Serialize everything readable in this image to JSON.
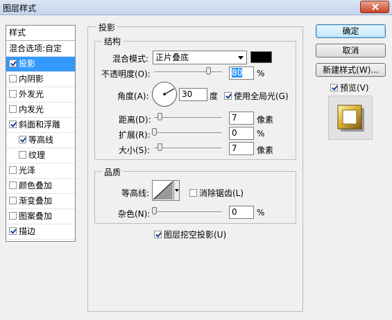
{
  "window": {
    "title": "图层样式"
  },
  "sidebar": {
    "header": "样式",
    "items": [
      {
        "label": "混合选项:自定",
        "checkbox": false,
        "checked": false,
        "selected": false,
        "sub": false
      },
      {
        "label": "投影",
        "checkbox": true,
        "checked": true,
        "selected": true,
        "sub": false
      },
      {
        "label": "内阴影",
        "checkbox": true,
        "checked": false,
        "selected": false,
        "sub": false
      },
      {
        "label": "外发光",
        "checkbox": true,
        "checked": false,
        "selected": false,
        "sub": false
      },
      {
        "label": "内发光",
        "checkbox": true,
        "checked": false,
        "selected": false,
        "sub": false
      },
      {
        "label": "斜面和浮雕",
        "checkbox": true,
        "checked": true,
        "selected": false,
        "sub": false
      },
      {
        "label": "等高线",
        "checkbox": true,
        "checked": true,
        "selected": false,
        "sub": true
      },
      {
        "label": "纹理",
        "checkbox": true,
        "checked": false,
        "selected": false,
        "sub": true
      },
      {
        "label": "光泽",
        "checkbox": true,
        "checked": false,
        "selected": false,
        "sub": false
      },
      {
        "label": "颜色叠加",
        "checkbox": true,
        "checked": false,
        "selected": false,
        "sub": false
      },
      {
        "label": "渐变叠加",
        "checkbox": true,
        "checked": false,
        "selected": false,
        "sub": false
      },
      {
        "label": "图案叠加",
        "checkbox": true,
        "checked": false,
        "selected": false,
        "sub": false
      },
      {
        "label": "描边",
        "checkbox": true,
        "checked": true,
        "selected": false,
        "sub": false
      }
    ]
  },
  "shadow": {
    "section_title": "投影",
    "structure_title": "结构",
    "blend_mode_label": "混合模式:",
    "blend_mode_value": "正片叠底",
    "shadow_color": "#000000",
    "opacity_label": "不透明度(O):",
    "opacity_value": "80",
    "opacity_unit": "%",
    "angle_label": "角度(A):",
    "angle_value": "30",
    "angle_unit": "度",
    "global_light_label": "使用全局光(G)",
    "global_light_checked": true,
    "distance_label": "距离(D):",
    "distance_value": "7",
    "distance_unit": "像素",
    "spread_label": "扩展(R):",
    "spread_value": "0",
    "spread_unit": "%",
    "size_label": "大小(S):",
    "size_value": "7",
    "size_unit": "像素",
    "quality_title": "品质",
    "contour_label": "等高线:",
    "anti_alias_label": "消除锯齿(L)",
    "anti_alias_checked": false,
    "noise_label": "杂色(N):",
    "noise_value": "0",
    "noise_unit": "%",
    "knockout_label": "图层挖空投影(U)",
    "knockout_checked": true
  },
  "buttons": {
    "ok": "确定",
    "cancel": "取消",
    "new_style": "新建样式(W)...",
    "preview_label": "预览(V)",
    "preview_checked": true
  }
}
